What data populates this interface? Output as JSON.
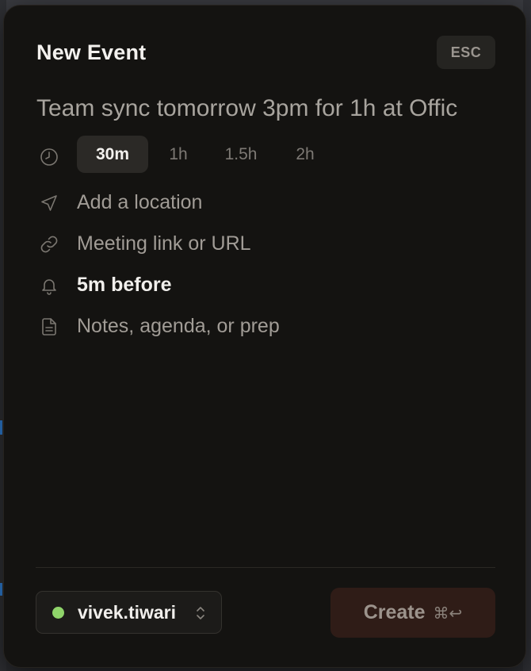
{
  "dialog": {
    "title": "New Event",
    "esc_label": "ESC",
    "event_title_value": "Team sync tomorrow 3pm for 1h at Offic",
    "durations": [
      {
        "label": "30m",
        "selected": true
      },
      {
        "label": "1h",
        "selected": false
      },
      {
        "label": "1.5h",
        "selected": false
      },
      {
        "label": "2h",
        "selected": false
      }
    ],
    "location_placeholder": "Add a location",
    "link_placeholder": "Meeting link or URL",
    "reminder_value": "5m before",
    "notes_placeholder": "Notes, agenda, or prep",
    "icons": {
      "duration": "clock-icon",
      "location": "navigation-arrow-icon",
      "link": "link-icon",
      "reminder": "bell-icon",
      "notes": "document-icon",
      "account_switch": "chevron-up-down-icon"
    }
  },
  "footer": {
    "account_name": "vivek.tiwari",
    "account_status_color": "#8fd46a",
    "create_label": "Create",
    "create_shortcut": "⌘↩"
  }
}
